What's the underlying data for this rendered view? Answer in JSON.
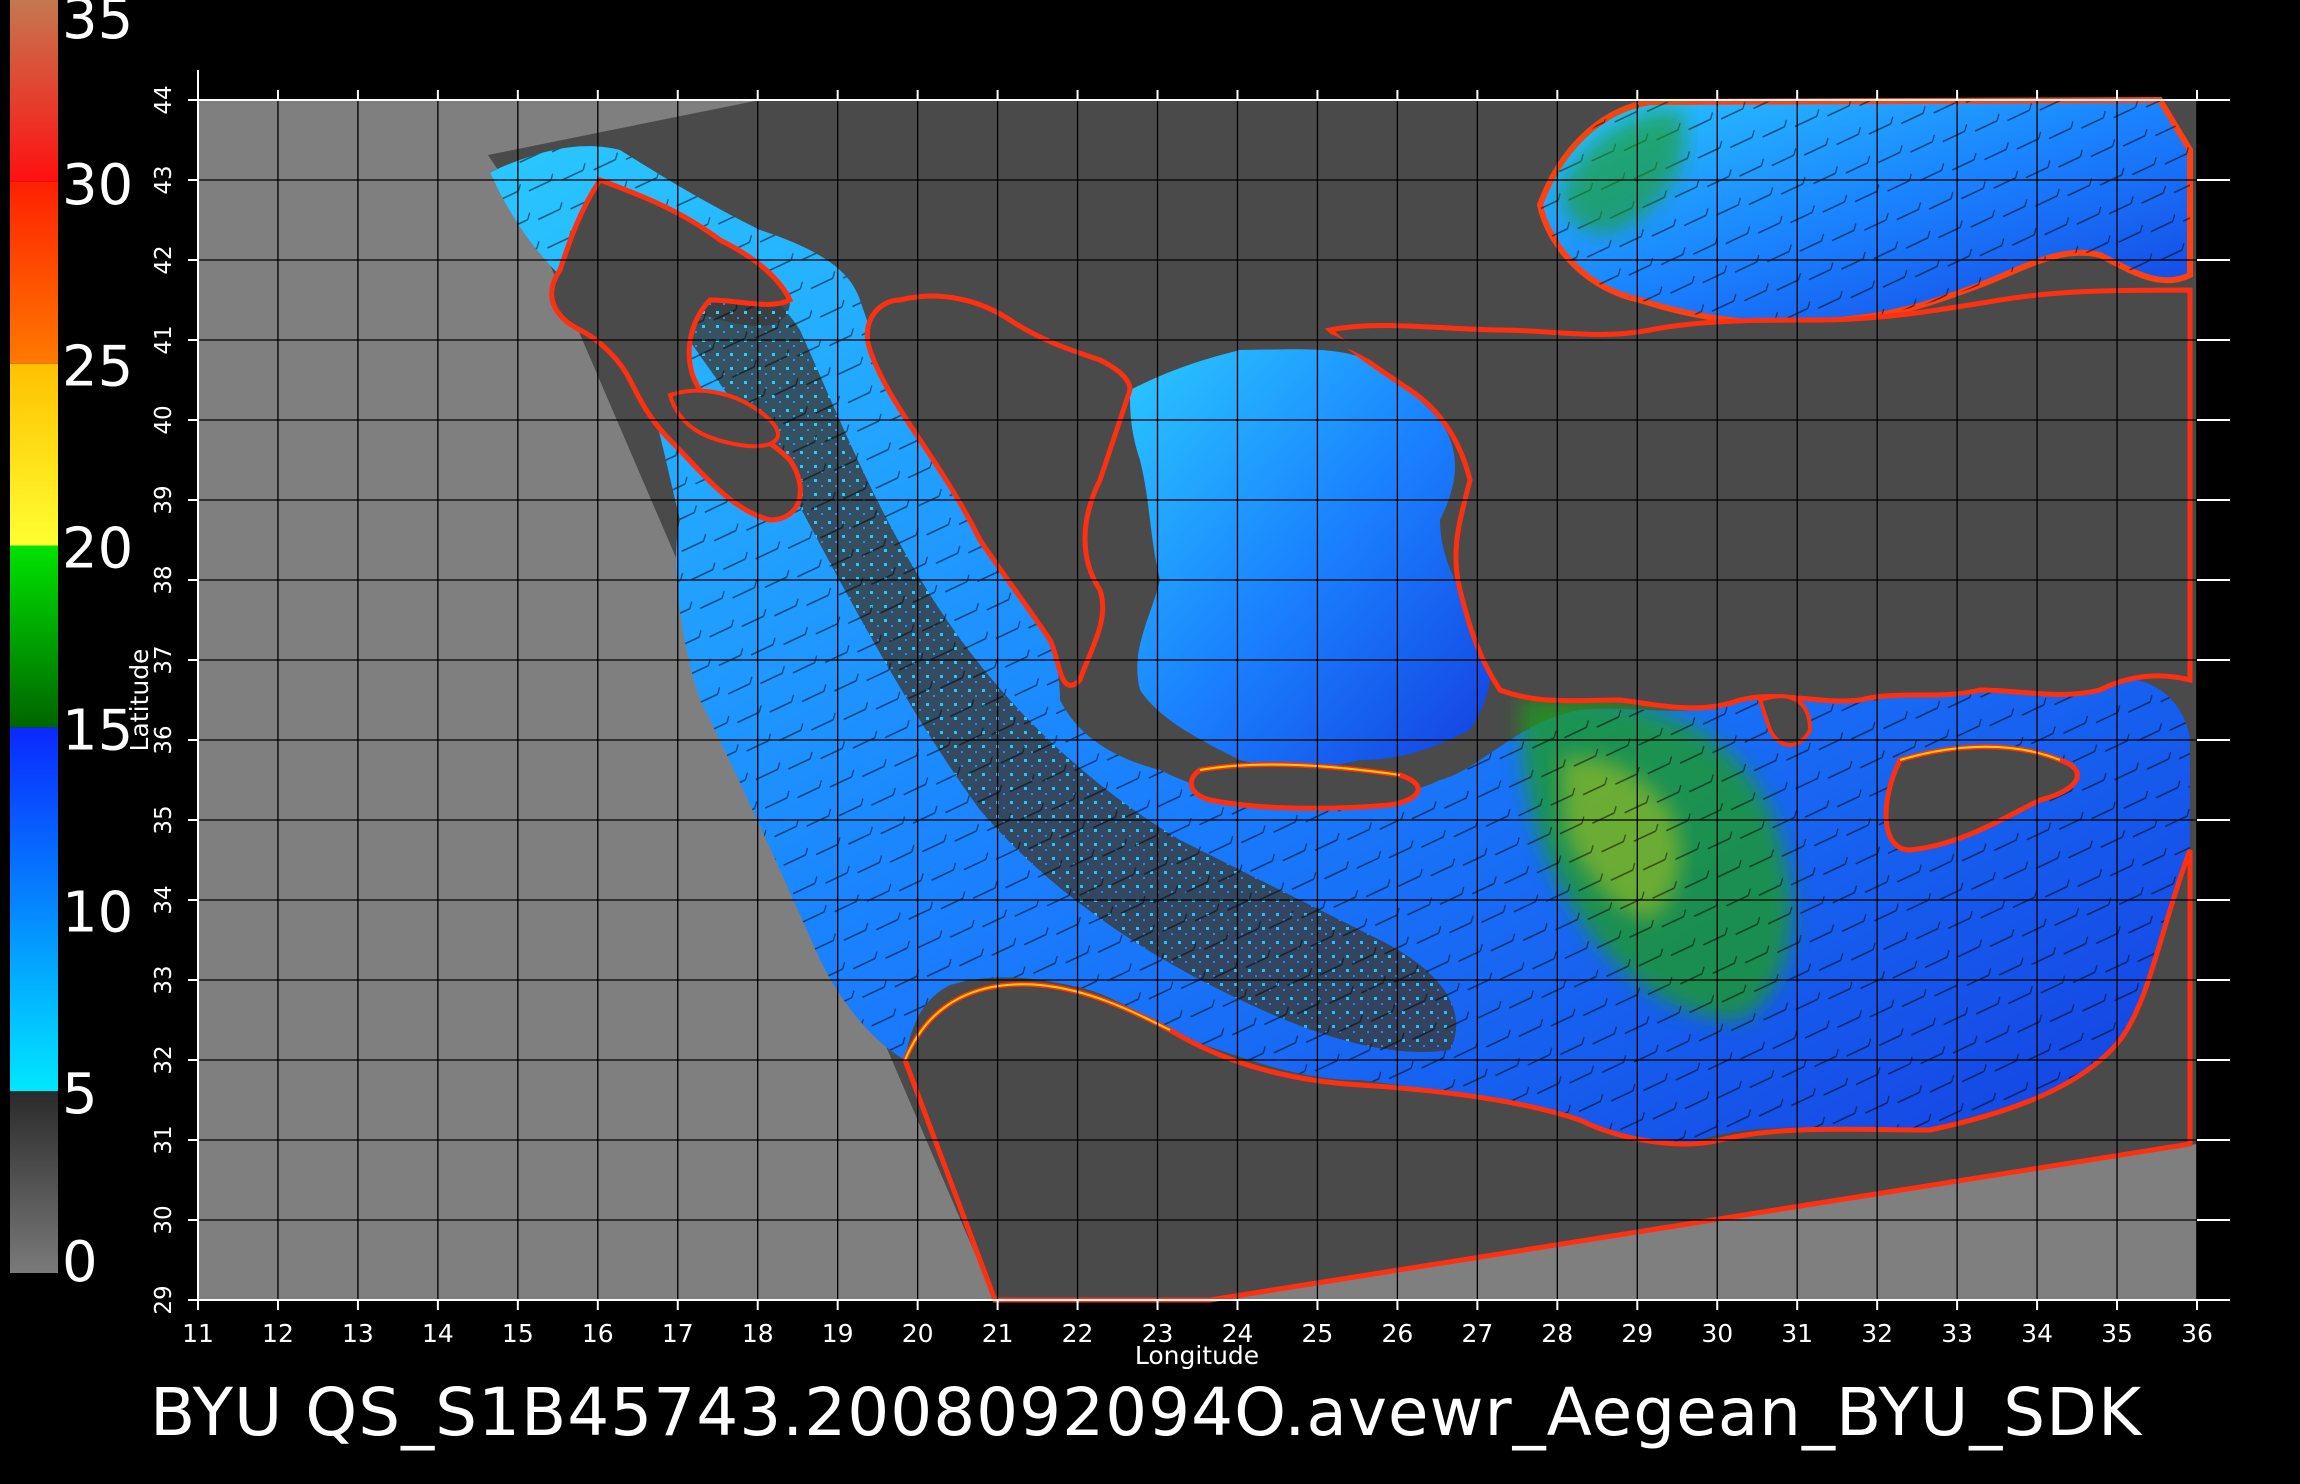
{
  "caption": "BYU  QS_S1B45743.2008092094O.avewr_Aegean_BYU_SDK",
  "axes": {
    "xlabel": "Longitude",
    "ylabel": "Latitude",
    "xticks": [
      "11",
      "12",
      "13",
      "14",
      "15",
      "16",
      "17",
      "18",
      "19",
      "20",
      "21",
      "22",
      "23",
      "24",
      "25",
      "26",
      "27",
      "28",
      "29",
      "30",
      "31",
      "32",
      "33",
      "34",
      "35",
      "36"
    ],
    "yticks": [
      "29",
      "30",
      "31",
      "32",
      "33",
      "34",
      "35",
      "36",
      "37",
      "38",
      "39",
      "40",
      "41",
      "42",
      "43",
      "44"
    ],
    "xlim": [
      11,
      36
    ],
    "ylim": [
      29,
      44
    ]
  },
  "colorbar": {
    "labels": [
      "0",
      "5",
      "10",
      "15",
      "20",
      "25",
      "30",
      "35"
    ],
    "range": [
      0,
      35
    ],
    "segments": [
      {
        "from": 0,
        "to": 5,
        "colors": [
          "#7a7a7a",
          "#2a2a2a"
        ]
      },
      {
        "from": 5,
        "to": 15,
        "colors": [
          "#00e8ff",
          "#0a28ff"
        ]
      },
      {
        "from": 15,
        "to": 20,
        "colors": [
          "#006400",
          "#00e400"
        ]
      },
      {
        "from": 20,
        "to": 25,
        "colors": [
          "#ffff30",
          "#ffc000"
        ]
      },
      {
        "from": 25,
        "to": 30,
        "colors": [
          "#ff7a00",
          "#ff2000"
        ]
      },
      {
        "from": 30,
        "to": 35,
        "colors": [
          "#ff1010",
          "#c47850"
        ]
      }
    ]
  },
  "colors": {
    "background": "#000000",
    "no_data": "#7f7f7f",
    "land": "#4a4a4a",
    "grid": "#000000",
    "sea_light": "#1fb4ff",
    "sea_dark": "#1446e6",
    "wind_mid": "#1e9e1e",
    "coast_red": "#ff3010",
    "coast_yellow": "#ffe000",
    "calm": "#3a3a3a"
  }
}
